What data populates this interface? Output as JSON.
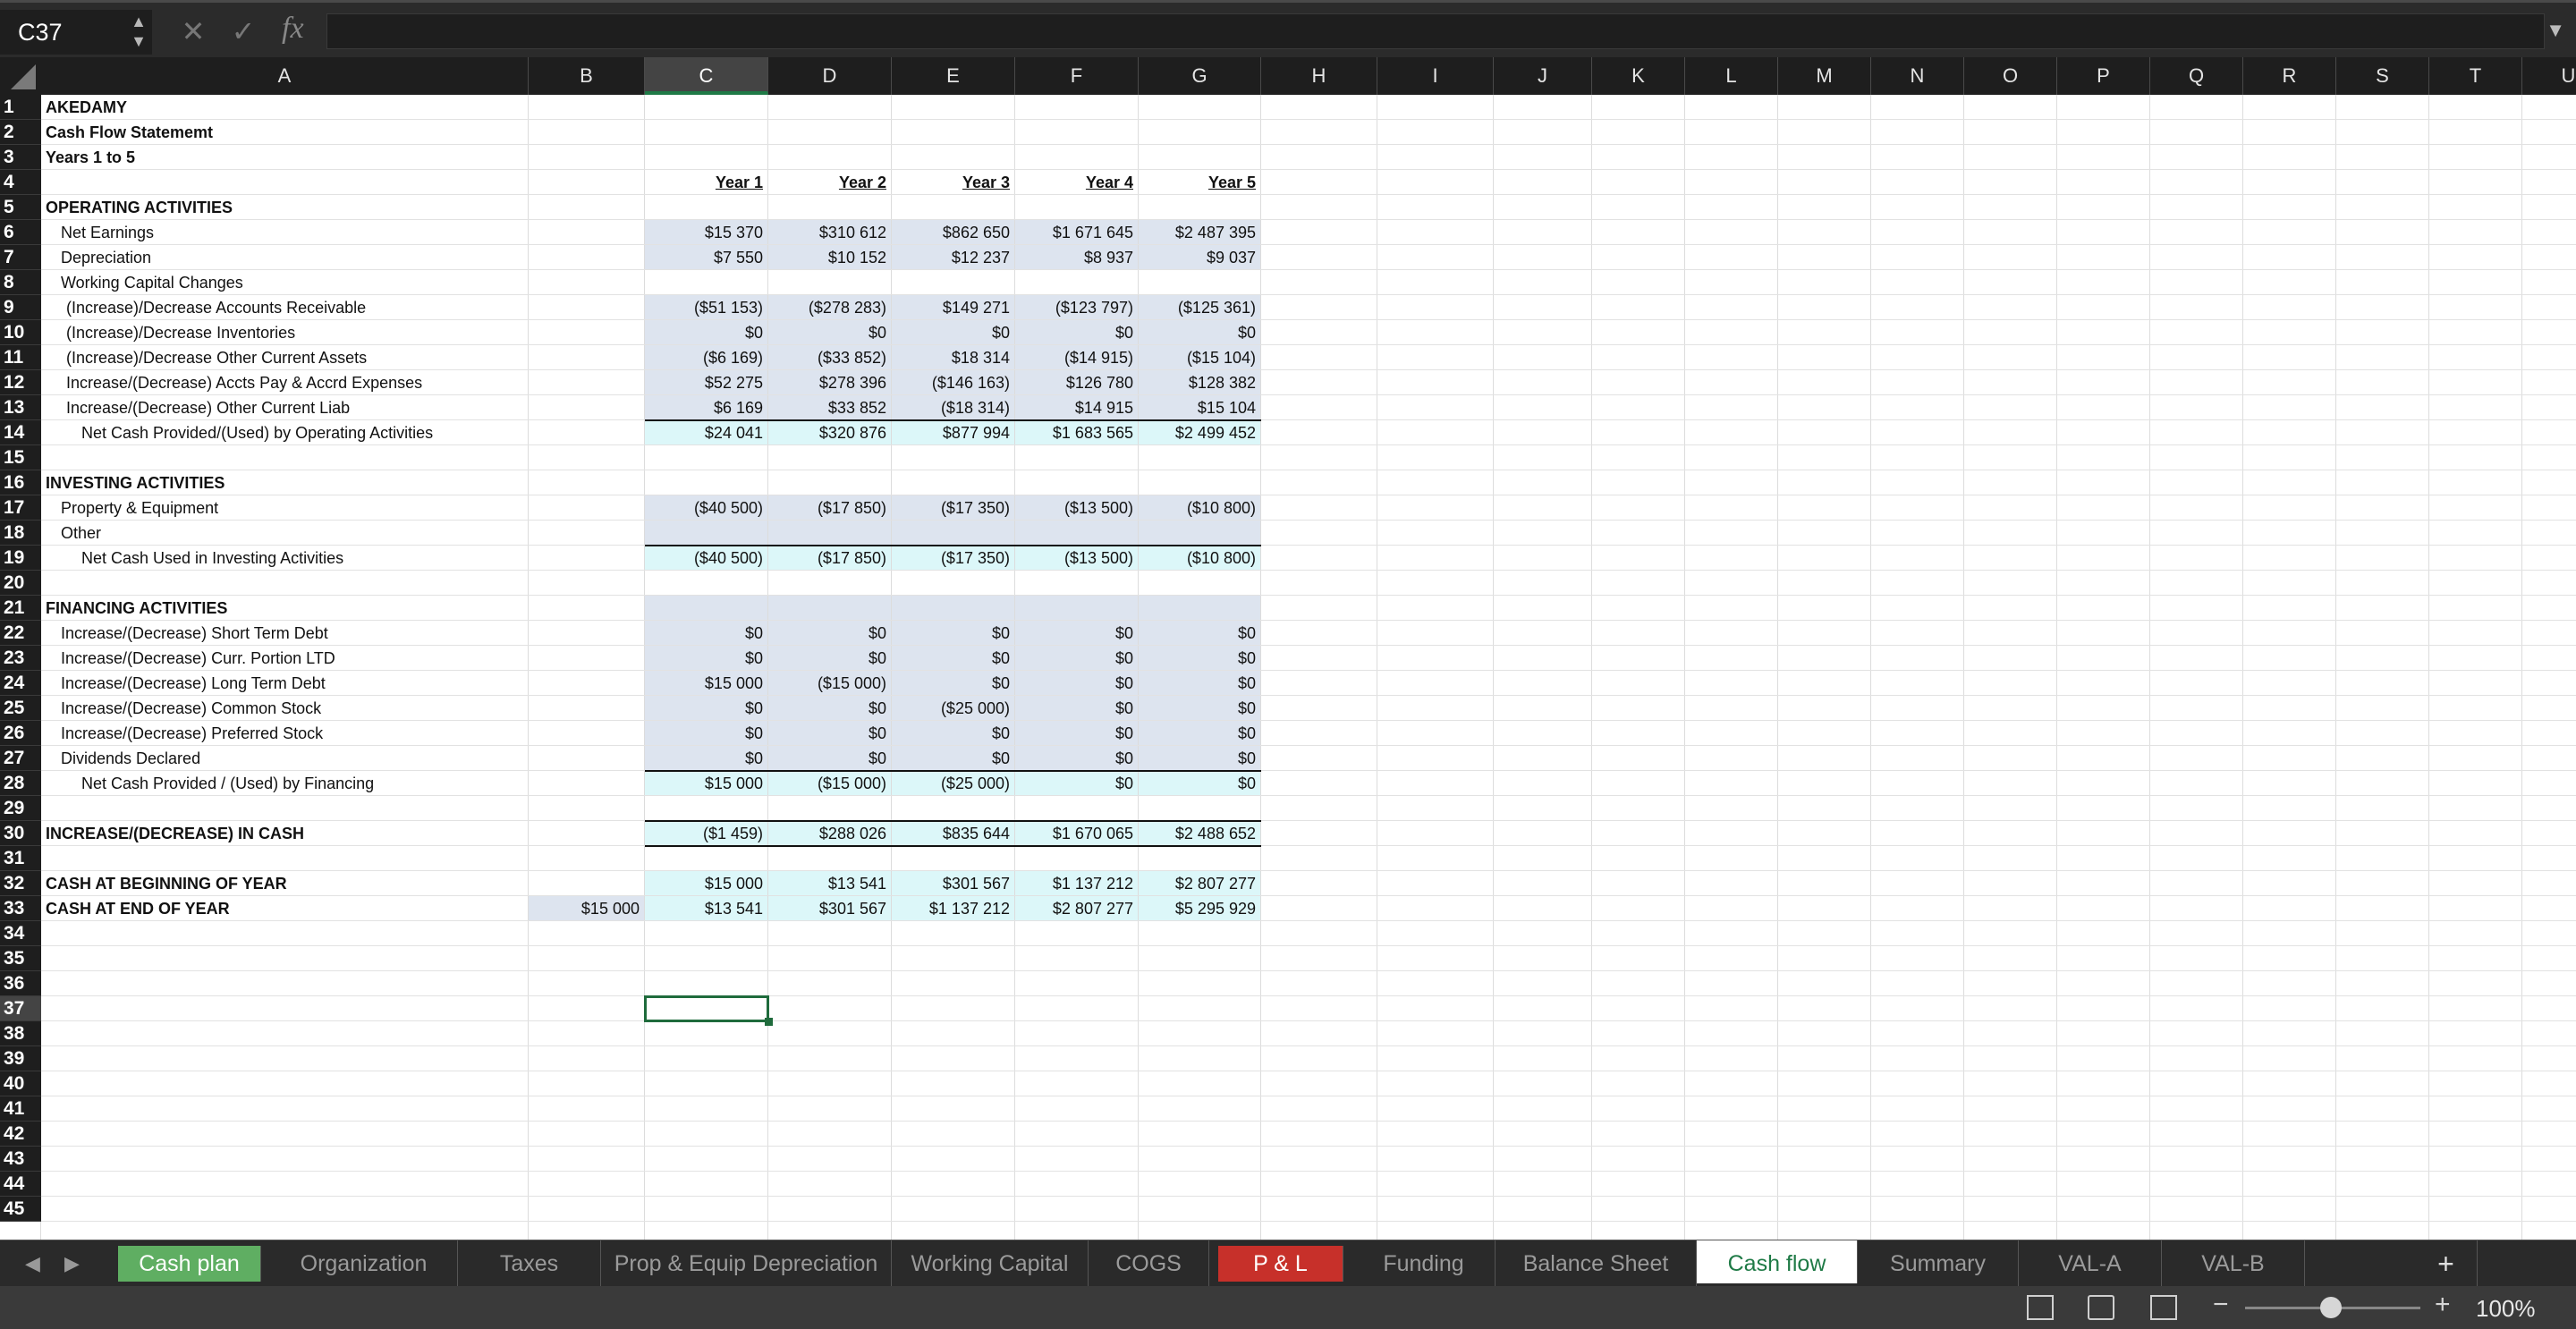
{
  "formula_bar": {
    "name_box": "C37",
    "fx": "fx",
    "formula": ""
  },
  "columns": [
    "A",
    "B",
    "C",
    "D",
    "E",
    "F",
    "G",
    "H",
    "I",
    "J",
    "K",
    "L",
    "M",
    "N",
    "O",
    "P",
    "Q",
    "R",
    "S",
    "T",
    "U"
  ],
  "selected_column": "C",
  "selected_row": 37,
  "selected_cell": "C37",
  "rows": [
    {
      "n": 1,
      "label": "AKEDAMY",
      "indent": 0,
      "bold": true
    },
    {
      "n": 2,
      "label": "Cash Flow Statememt",
      "indent": 0,
      "bold": true
    },
    {
      "n": 3,
      "label": "Years 1 to 5",
      "indent": 0,
      "bold": true
    },
    {
      "n": 4,
      "label": "",
      "values": [
        "Year 1",
        "Year 2",
        "Year 3",
        "Year 4",
        "Year 5"
      ],
      "header": true
    },
    {
      "n": 5,
      "label": "OPERATING ACTIVITIES",
      "indent": 0,
      "bold": true
    },
    {
      "n": 6,
      "label": "Net Earnings",
      "indent": 1,
      "values": [
        "$15 370",
        "$310 612",
        "$862 650",
        "$1 671 645",
        "$2 487 395"
      ],
      "fill": "band"
    },
    {
      "n": 7,
      "label": "Depreciation",
      "indent": 1,
      "values": [
        "$7 550",
        "$10 152",
        "$12 237",
        "$8 937",
        "$9 037"
      ],
      "fill": "band"
    },
    {
      "n": 8,
      "label": "Working Capital Changes",
      "indent": 1
    },
    {
      "n": 9,
      "label": "(Increase)/Decrease Accounts Receivable",
      "indent": 2,
      "values": [
        "($51 153)",
        "($278 283)",
        "$149 271",
        "($123 797)",
        "($125 361)"
      ],
      "fill": "band"
    },
    {
      "n": 10,
      "label": "(Increase)/Decrease Inventories",
      "indent": 2,
      "values": [
        "$0",
        "$0",
        "$0",
        "$0",
        "$0"
      ],
      "fill": "band"
    },
    {
      "n": 11,
      "label": "(Increase)/Decrease Other Current Assets",
      "indent": 2,
      "values": [
        "($6 169)",
        "($33 852)",
        "$18 314",
        "($14 915)",
        "($15 104)"
      ],
      "fill": "band"
    },
    {
      "n": 12,
      "label": "Increase/(Decrease) Accts Pay & Accrd Expenses",
      "indent": 2,
      "values": [
        "$52 275",
        "$278 396",
        "($146 163)",
        "$126 780",
        "$128 382"
      ],
      "fill": "band"
    },
    {
      "n": 13,
      "label": "Increase/(Decrease) Other Current Liab",
      "indent": 2,
      "values": [
        "$6 169",
        "$33 852",
        "($18 314)",
        "$14 915",
        "$15 104"
      ],
      "fill": "band"
    },
    {
      "n": 14,
      "label": "Net Cash Provided/(Used) by Operating Activities",
      "indent": 3,
      "values": [
        "$24 041",
        "$320 876",
        "$877 994",
        "$1 683 565",
        "$2 499 452"
      ],
      "fill": "total",
      "line_top": true
    },
    {
      "n": 15,
      "label": ""
    },
    {
      "n": 16,
      "label": "INVESTING ACTIVITIES",
      "indent": 0,
      "bold": true
    },
    {
      "n": 17,
      "label": "Property & Equipment",
      "indent": 1,
      "values": [
        "($40 500)",
        "($17 850)",
        "($17 350)",
        "($13 500)",
        "($10 800)"
      ],
      "fill": "band"
    },
    {
      "n": 18,
      "label": "Other",
      "indent": 1,
      "fill": "band"
    },
    {
      "n": 19,
      "label": "Net Cash Used in Investing Activities",
      "indent": 3,
      "values": [
        "($40 500)",
        "($17 850)",
        "($17 350)",
        "($13 500)",
        "($10 800)"
      ],
      "fill": "total",
      "line_top": true
    },
    {
      "n": 20,
      "label": ""
    },
    {
      "n": 21,
      "label": "FINANCING ACTIVITIES",
      "indent": 0,
      "bold": true,
      "fill": "band"
    },
    {
      "n": 22,
      "label": "Increase/(Decrease) Short Term Debt",
      "indent": 1,
      "values": [
        "$0",
        "$0",
        "$0",
        "$0",
        "$0"
      ],
      "fill": "band"
    },
    {
      "n": 23,
      "label": "Increase/(Decrease) Curr. Portion LTD",
      "indent": 1,
      "values": [
        "$0",
        "$0",
        "$0",
        "$0",
        "$0"
      ],
      "fill": "band"
    },
    {
      "n": 24,
      "label": "Increase/(Decrease) Long Term Debt",
      "indent": 1,
      "values": [
        "$15 000",
        "($15 000)",
        "$0",
        "$0",
        "$0"
      ],
      "fill": "band"
    },
    {
      "n": 25,
      "label": "Increase/(Decrease) Common Stock",
      "indent": 1,
      "values": [
        "$0",
        "$0",
        "($25 000)",
        "$0",
        "$0"
      ],
      "fill": "band"
    },
    {
      "n": 26,
      "label": "Increase/(Decrease) Preferred Stock",
      "indent": 1,
      "values": [
        "$0",
        "$0",
        "$0",
        "$0",
        "$0"
      ],
      "fill": "band"
    },
    {
      "n": 27,
      "label": "Dividends Declared",
      "indent": 1,
      "values": [
        "$0",
        "$0",
        "$0",
        "$0",
        "$0"
      ],
      "fill": "band"
    },
    {
      "n": 28,
      "label": "Net Cash Provided / (Used) by Financing",
      "indent": 3,
      "values": [
        "$15 000",
        "($15 000)",
        "($25 000)",
        "$0",
        "$0"
      ],
      "fill": "total",
      "line_top": true
    },
    {
      "n": 29,
      "label": ""
    },
    {
      "n": 30,
      "label": "INCREASE/(DECREASE) IN CASH",
      "indent": 0,
      "bold": true,
      "values": [
        "($1 459)",
        "$288 026",
        "$835 644",
        "$1 670 065",
        "$2 488 652"
      ],
      "fill": "total",
      "line_top": true,
      "line_bottom": true
    },
    {
      "n": 31,
      "label": ""
    },
    {
      "n": 32,
      "label": "CASH AT BEGINNING OF YEAR",
      "indent": 0,
      "bold": true,
      "values": [
        "$15 000",
        "$13 541",
        "$301 567",
        "$1 137 212",
        "$2 807 277"
      ],
      "fill": "total"
    },
    {
      "n": 33,
      "label": "CASH AT END OF YEAR",
      "indent": 0,
      "bold": true,
      "b_value": "$15 000",
      "values": [
        "$13 541",
        "$301 567",
        "$1 137 212",
        "$2 807 277",
        "$5 295 929"
      ],
      "fill": "total"
    },
    {
      "n": 34,
      "label": ""
    },
    {
      "n": 35,
      "label": ""
    },
    {
      "n": 36,
      "label": ""
    },
    {
      "n": 37,
      "label": ""
    },
    {
      "n": 38,
      "label": ""
    },
    {
      "n": 39,
      "label": ""
    },
    {
      "n": 40,
      "label": ""
    },
    {
      "n": 41,
      "label": ""
    },
    {
      "n": 42,
      "label": ""
    },
    {
      "n": 43,
      "label": ""
    },
    {
      "n": 44,
      "label": ""
    },
    {
      "n": 45,
      "label": ""
    }
  ],
  "sheet_tabs": [
    {
      "label": "Cash plan",
      "style": "green"
    },
    {
      "label": "Organization",
      "style": ""
    },
    {
      "label": "Taxes",
      "style": ""
    },
    {
      "label": "Prop & Equip Depreciation",
      "style": ""
    },
    {
      "label": "Working Capital",
      "style": ""
    },
    {
      "label": "COGS",
      "style": ""
    },
    {
      "label": "P & L",
      "style": "red"
    },
    {
      "label": "Funding",
      "style": ""
    },
    {
      "label": "Balance Sheet",
      "style": ""
    },
    {
      "label": "Cash flow",
      "style": "active"
    },
    {
      "label": "Summary",
      "style": ""
    },
    {
      "label": "VAL-A",
      "style": ""
    },
    {
      "label": "VAL-B",
      "style": ""
    }
  ],
  "add_sheet": "+",
  "zoom": "100%",
  "colors": {
    "band": "#dde4ef",
    "total": "#dcf7f9",
    "accent": "#1f7a46",
    "p_and_l_tab": "#c7302a",
    "cash_plan_tab": "#5fae62"
  }
}
